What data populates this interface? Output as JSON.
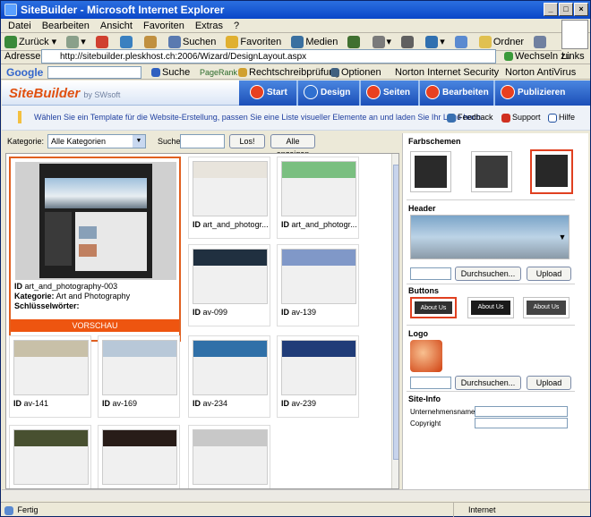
{
  "window": {
    "title": "SiteBuilder - Microsoft Internet Explorer"
  },
  "menu": [
    "Datei",
    "Bearbeiten",
    "Ansicht",
    "Favoriten",
    "Extras",
    "?"
  ],
  "toolbar": {
    "back": "Zurück",
    "search": "Suchen",
    "favorites": "Favoriten",
    "media": "Medien",
    "folders": "Ordner"
  },
  "address": {
    "label": "Adresse",
    "url": "http://sitebuilder.pleskhost.ch:2006/Wizard/DesignLayout.aspx",
    "go": "Wechseln zu",
    "links": "Links"
  },
  "google": {
    "brand": "Google",
    "search": "Suche",
    "pagerank": "PageRank",
    "spell": "Rechtschreibprüfung",
    "options": "Optionen",
    "norton_security": "Norton Internet Security",
    "norton_av": "Norton AntiVirus"
  },
  "sitebuilder": {
    "logo": "SiteBuilder",
    "logo_by": "by SWsoft",
    "steps": [
      "Start",
      "Design",
      "Seiten",
      "Bearbeiten",
      "Publizieren"
    ],
    "info": "Wählen Sie ein Template für die Website-Erstellung, passen Sie eine Liste visueller Elemente an und laden Sie Ihr Logo hoch.",
    "feedback": "Feedback",
    "support": "Support",
    "help": "Hilfe"
  },
  "filter": {
    "category_label": "Kategorie:",
    "category_value": "Alle Kategorien",
    "search_label": "Suche",
    "go": "Los!",
    "show_all": "Alle anzeigen"
  },
  "selected_template": {
    "id_label": "ID",
    "id": "art_and_photography-003",
    "category_label": "Kategorie:",
    "category": "Art and Photography",
    "keywords_label": "Schlüsselwörter:",
    "preview": "VORSCHAU"
  },
  "templates": [
    {
      "id": "art_and_photogr...",
      "color": "#e8e4dc"
    },
    {
      "id": "art_and_photogr...",
      "color": "#7abf80"
    },
    {
      "id": "av-099",
      "color": "#203040"
    },
    {
      "id": "av-139",
      "color": "#8098c8"
    },
    {
      "id": "av-141",
      "color": "#c8c0a8"
    },
    {
      "id": "av-169",
      "color": "#b8c8d8"
    },
    {
      "id": "av-234",
      "color": "#3070a8"
    },
    {
      "id": "av-239",
      "color": "#203c78"
    },
    {
      "id": "",
      "color": "#485030"
    },
    {
      "id": "",
      "color": "#281c18"
    },
    {
      "id": "",
      "color": "#c8c8c8"
    }
  ],
  "right": {
    "schemes": "Farbschemen",
    "header": "Header",
    "browse": "Durchsuchen...",
    "upload": "Upload",
    "buttons": "Buttons",
    "button_text": "About Us",
    "logo": "Logo",
    "siteinfo": "Site-Info",
    "company": "Unternehmensname",
    "copyright": "Copyright"
  },
  "status": {
    "left": "Fertig",
    "zone": "Internet"
  }
}
